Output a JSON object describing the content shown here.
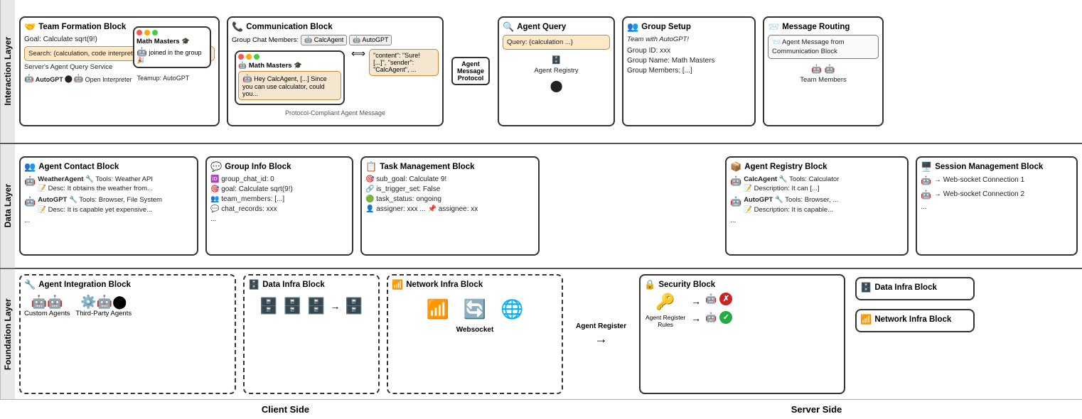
{
  "layers": {
    "interaction": "Interaction Layer",
    "data": "Data Layer",
    "foundation": "Foundation Layer"
  },
  "captions": {
    "client": "Client Side",
    "server": "Server Side"
  },
  "interaction": {
    "team_formation": {
      "title": "Team Formation Block",
      "icon": "🤝",
      "goal": "Goal: Calculate sqrt(9!)",
      "search": "Search: {calculation, code interpreter}",
      "query_service": "Server's Agent Query Service",
      "teamup": "Teamup: AutoGPT",
      "agents": [
        "AutoGPT",
        "Open Interpreter"
      ],
      "math_masters_inner": {
        "title": "Math Masters 🎓",
        "joined": "joined in the group 🎉"
      }
    },
    "communication": {
      "title": "Communication Block",
      "icon": "📞",
      "members_label": "Group Chat Members:",
      "members": [
        "🤖 CalcAgent",
        "🤖 AutoGPT"
      ],
      "chat_window": {
        "title": "Math Masters 🎓",
        "message": "Hey CalcAgent, [...] Since you can use calculator, could you..."
      },
      "json_content": "\"content\": \"Sure! [...]\", \"sender\": \"CalcAgent\", ...",
      "protocol_label": "Protocol-Compliant Agent Message"
    },
    "agent_query": {
      "title": "Agent Query",
      "icon": "🔍",
      "query": "Query: {calculation ...}",
      "label": "Agent Message Protocol",
      "agent_registry": "Agent Registry"
    },
    "group_setup": {
      "title": "Group Setup",
      "icon": "👥",
      "team": "Team with AutoGPT!",
      "group_id": "Group ID: xxx",
      "group_name": "Group Name: Math Masters",
      "group_members": "Group Members: [...]"
    },
    "message_routing": {
      "title": "Message Routing",
      "icon": "📨",
      "description": "Agent Message from Communication Block",
      "team_members": "Team Members"
    }
  },
  "data_layer": {
    "agent_contact": {
      "title": "Agent Contact Block",
      "icon": "👥",
      "items": [
        {
          "name": "WeatherAgent",
          "tools": "🔧 Tools: Weather API",
          "desc": "📝 Desc: It obtains the weather from..."
        },
        {
          "name": "AutoGPT",
          "tools": "🔧 Tools: Browser, File System",
          "desc": "📝 Desc: It is capable yet expensive..."
        }
      ],
      "ellipsis": "..."
    },
    "group_info": {
      "title": "Group Info Block",
      "icon": "💬",
      "fields": [
        "🆔 group_chat_id: 0",
        "🎯 goal: Calculate sqrt(9!)",
        "👥 team_members: [...]",
        "💬 chat_records: xxx",
        "..."
      ]
    },
    "task_management": {
      "title": "Task Management Block",
      "icon": "📋",
      "fields": [
        "🎯 sub_goal: Calculate 9!",
        "🔗 is_trigger_set: False",
        "🟢 task_status: ongoing",
        "👤 assigner: xxx ... 📌 assignee: xx"
      ]
    },
    "agent_registry": {
      "title": "Agent Registry Block",
      "icon": "📦",
      "items": [
        {
          "name": "CalcAgent",
          "tools": "🔧 Tools: Calculator",
          "desc": "📝 Description: It can [...]"
        },
        {
          "name": "AutoGPT",
          "tools": "🔧 Tools: Browser, ...",
          "desc": "📝 Description: It is capable..."
        }
      ],
      "ellipsis": "..."
    },
    "session_management": {
      "title": "Session Management Block",
      "icon": "🖥️",
      "connections": [
        "→ Web-socket Connection 1",
        "→ Web-socket Connection 2",
        "..."
      ]
    }
  },
  "foundation": {
    "agent_integration": {
      "title": "Agent Integration Block",
      "icon": "🔧",
      "custom_agents": "Custom Agents",
      "third_party": "Third-Party Agents"
    },
    "data_infra_client": {
      "title": "Data Infra Block",
      "icon": "🗄️"
    },
    "network_infra_client": {
      "title": "Network Infra Block",
      "icon": "📶",
      "websocket": "Websocket"
    },
    "security_block": {
      "title": "Security Block",
      "icon": "🔒",
      "label": "Agent Register",
      "rules": "Agent Register Rules",
      "approved": "✓",
      "rejected": "✗"
    },
    "data_infra_server": {
      "title": "Data Infra Block",
      "icon": "🗄️"
    },
    "network_infra_server": {
      "title": "Network Infra Block",
      "icon": "📶"
    }
  }
}
